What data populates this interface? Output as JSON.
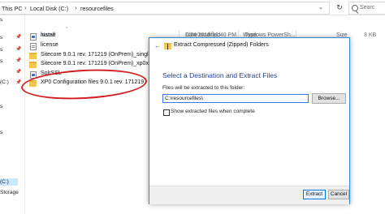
{
  "address_bar": {
    "crumbs": [
      "This PC",
      "Local Disk (C:)",
      "resourcefiles"
    ],
    "search_placeholder": "Searc"
  },
  "nav": {
    "items": [
      "s",
      "s",
      "s",
      "s",
      "(C:)",
      "s",
      "s",
      "(C:)",
      "Storage"
    ]
  },
  "columns": {
    "name": "Name",
    "date_modified": "Date modified",
    "type": "Type",
    "size": "Size"
  },
  "files": [
    {
      "name": "install",
      "date": "1/24/2018 12:40 PM",
      "type": "Windows PowerSh...",
      "size": "3 KB",
      "icon": "powershell-script-icon"
    },
    {
      "name": "license",
      "date": "",
      "type": "",
      "size": "",
      "icon": "text-document-icon"
    },
    {
      "name": "Sitecore 9.0.1 rev. 171219 (OnPrem)_single.scw",
      "date": "",
      "type": "",
      "size": "",
      "icon": "zip-folder-icon"
    },
    {
      "name": "Sitecore 9.0.1 rev. 171219 (OnPrem)_xp0xconn",
      "date": "",
      "type": "",
      "size": "",
      "icon": "zip-folder-icon"
    },
    {
      "name": "SolrSSL",
      "date": "",
      "type": "",
      "size": "",
      "icon": "powershell-script-icon"
    },
    {
      "name": "XP0 Configuration files 9.0.1 rev. 171219",
      "date": "",
      "type": "",
      "size": "",
      "icon": "zip-folder-icon"
    }
  ],
  "dialog": {
    "title": "Extract Compressed (Zipped) Folders",
    "heading": "Select a Destination and Extract Files",
    "path_label": "Files will be extracted to this folder:",
    "path_value": "C:\\resourcefiles\\",
    "browse_label": "Browse...",
    "checkbox_label": "Show extracted files when complete",
    "checkbox_checked": false,
    "extract_label": "Extract",
    "cancel_label": "Cancel"
  },
  "colors": {
    "annotation_red": "#d21f1f",
    "dialog_border": "#2f8ad6",
    "heading_blue": "#1f3fa0",
    "folder_yellow": "#f5c84c"
  }
}
